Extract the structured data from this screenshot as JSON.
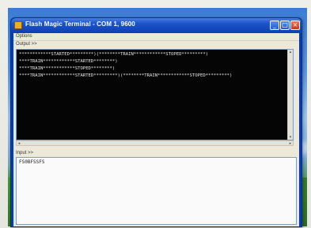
{
  "window": {
    "title": "Flash Magic Terminal - COM 1, 9600",
    "minimize_glyph": "_",
    "maximize_glyph": "□",
    "close_glyph": "×"
  },
  "menu": {
    "options_label": "Options"
  },
  "output": {
    "label": "Output >>",
    "lines": [
      "************STARTED*********)(********TRAIN************STOPED*********)",
      "****TRAIN************STARTED********)",
      "****TRAIN************STOPED********)",
      "****TRAIN************STARTED*********)(********TRAIN************STOPED*********)"
    ]
  },
  "input": {
    "label": "Input >>",
    "value": "FS0BFSSFS"
  },
  "colors": {
    "titlebar": "#1c54c9",
    "terminal_bg": "#050505",
    "terminal_fg": "#e8e8e8",
    "close_button": "#c8321c"
  },
  "icons": [
    "app-icon",
    "minimize-icon",
    "maximize-icon",
    "close-icon"
  ]
}
